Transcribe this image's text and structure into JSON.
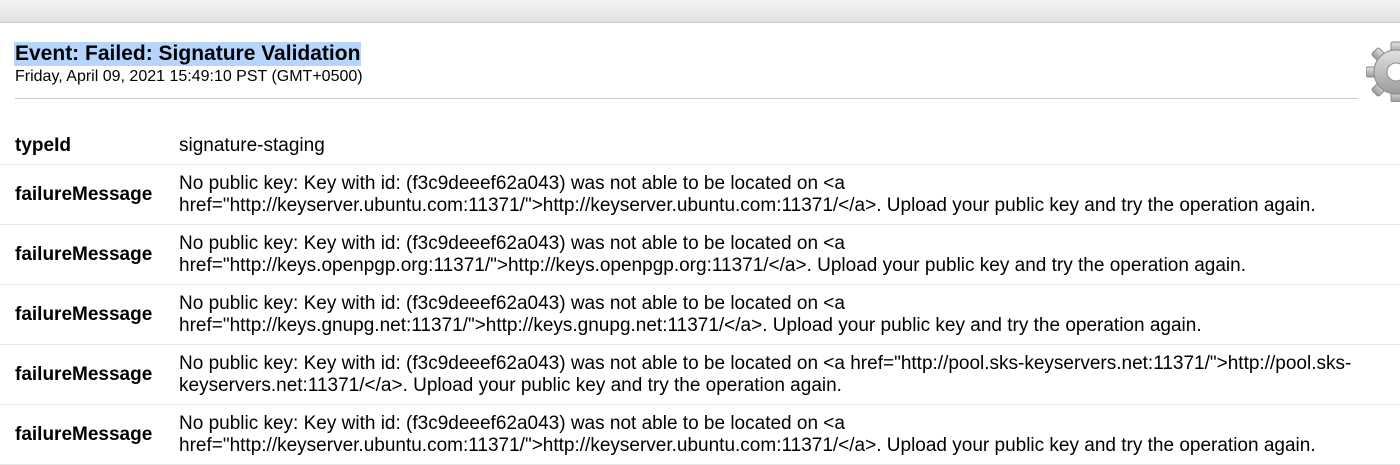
{
  "event": {
    "title": "Event: Failed: Signature Validation",
    "timestamp": "Friday, April 09, 2021 15:49:10 PST (GMT+0500)"
  },
  "icons": {
    "settings": "gear-icon"
  },
  "rows": [
    {
      "key": "typeId",
      "value": "signature-staging"
    },
    {
      "key": "failureMessage",
      "value": "No public key: Key with id: (f3c9deeef62a043) was not able to be located on <a\nhref=\"http://keyserver.ubuntu.com:11371/\">http://keyserver.ubuntu.com:11371/</a>. Upload your public key and try the operation again."
    },
    {
      "key": "failureMessage",
      "value": "No public key: Key with id: (f3c9deeef62a043) was not able to be located on <a\nhref=\"http://keys.openpgp.org:11371/\">http://keys.openpgp.org:11371/</a>. Upload your public key and try the operation again."
    },
    {
      "key": "failureMessage",
      "value": "No public key: Key with id: (f3c9deeef62a043) was not able to be located on <a\nhref=\"http://keys.gnupg.net:11371/\">http://keys.gnupg.net:11371/</a>. Upload your public key and try the operation again."
    },
    {
      "key": "failureMessage",
      "value": "No public key: Key with id: (f3c9deeef62a043) was not able to be located on <a href=\"http://pool.sks-keyservers.net:11371/\">http://pool.sks-\nkeyservers.net:11371/</a>. Upload your public key and try the operation again."
    },
    {
      "key": "failureMessage",
      "value": "No public key: Key with id: (f3c9deeef62a043) was not able to be located on <a\nhref=\"http://keyserver.ubuntu.com:11371/\">http://keyserver.ubuntu.com:11371/</a>. Upload your public key and try the operation again."
    }
  ]
}
